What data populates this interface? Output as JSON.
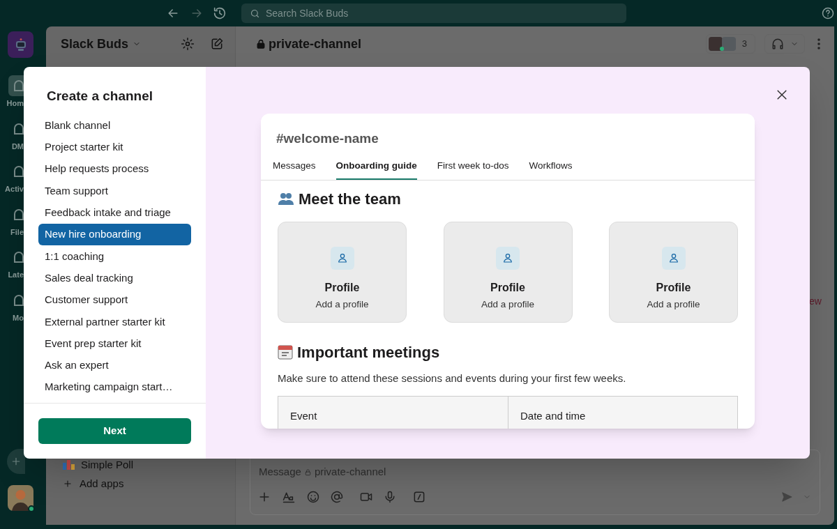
{
  "top_bar": {
    "search": {
      "placeholder": "Search Slack Buds"
    }
  },
  "rail": {
    "items": [
      {
        "label": "Hom",
        "selected": true
      },
      {
        "label": "DM",
        "selected": false
      },
      {
        "label": "Activ",
        "selected": false
      },
      {
        "label": "File",
        "selected": false
      },
      {
        "label": "Late",
        "selected": false
      },
      {
        "label": "Mo",
        "selected": false
      }
    ]
  },
  "sidebar": {
    "workspace": "Slack Buds",
    "apps": [
      "Simple Poll"
    ],
    "add_apps": "Add apps"
  },
  "channel": {
    "name": "private-channel",
    "member_count": "3",
    "cut_text": "ew"
  },
  "composer": {
    "placeholder": "Message",
    "channel": "private-channel"
  },
  "modal": {
    "title": "Create a channel",
    "templates": [
      {
        "label": "Blank channel",
        "selected": false
      },
      {
        "label": "Project starter kit",
        "selected": false
      },
      {
        "label": "Help requests process",
        "selected": false
      },
      {
        "label": "Team support",
        "selected": false
      },
      {
        "label": "Feedback intake and triage",
        "selected": false
      },
      {
        "label": "New hire onboarding",
        "selected": true
      },
      {
        "label": "1:1 coaching",
        "selected": false
      },
      {
        "label": "Sales deal tracking",
        "selected": false
      },
      {
        "label": "Customer support",
        "selected": false
      },
      {
        "label": "External partner starter kit",
        "selected": false
      },
      {
        "label": "Event prep starter kit",
        "selected": false
      },
      {
        "label": "Ask an expert",
        "selected": false
      },
      {
        "label": "Marketing campaign start…",
        "selected": false
      }
    ],
    "next_button": "Next",
    "preview": {
      "channel_name": "#welcome-name",
      "tabs": [
        {
          "label": "Messages",
          "selected": false
        },
        {
          "label": "Onboarding guide",
          "selected": true
        },
        {
          "label": "First week to-dos",
          "selected": false
        },
        {
          "label": "Workflows",
          "selected": false
        }
      ],
      "team_heading": "Meet the team",
      "profiles": [
        {
          "title": "Profile",
          "subtitle": "Add a profile"
        },
        {
          "title": "Profile",
          "subtitle": "Add a profile"
        },
        {
          "title": "Profile",
          "subtitle": "Add a profile"
        }
      ],
      "meetings_heading": "Important meetings",
      "meetings_text": "Make sure to attend these sessions and events during your first few weeks.",
      "table": {
        "columns": [
          "Event",
          "Date and time"
        ]
      }
    }
  }
}
